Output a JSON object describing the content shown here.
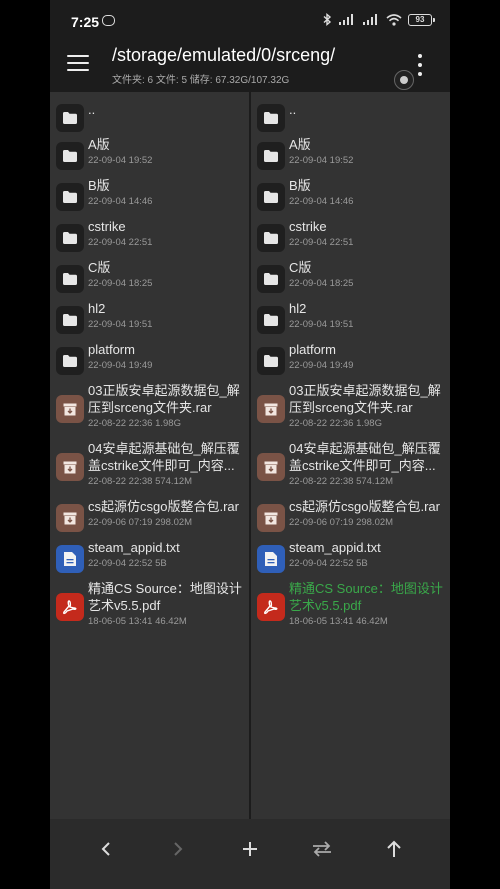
{
  "status": {
    "time": "7:25",
    "battery": "93"
  },
  "appbar": {
    "path": "/storage/emulated/0/srceng/",
    "info": "文件夹: 6  文件: 5  储存: 67.32G/107.32G"
  },
  "left_pane": {
    "items": [
      {
        "name": "..",
        "meta": "",
        "kind": "folder"
      },
      {
        "name": "A版",
        "meta": "22-09-04 19:52",
        "kind": "folder"
      },
      {
        "name": "B版",
        "meta": "22-09-04 14:46",
        "kind": "folder"
      },
      {
        "name": "cstrike",
        "meta": "22-09-04 22:51",
        "kind": "folder"
      },
      {
        "name": "C版",
        "meta": "22-09-04 18:25",
        "kind": "folder"
      },
      {
        "name": "hl2",
        "meta": "22-09-04 19:51",
        "kind": "folder"
      },
      {
        "name": "platform",
        "meta": "22-09-04 19:49",
        "kind": "folder"
      },
      {
        "name": "03正版安卓起源数据包_解压到srceng文件夹.rar",
        "meta": "22-08-22 22:36  1.98G",
        "kind": "rar"
      },
      {
        "name": "04安卓起源基础包_解压覆盖cstrike文件即可_内容...",
        "meta": "22-08-22 22:38  574.12M",
        "kind": "rar"
      },
      {
        "name": "cs起源仿csgo版整合包.rar",
        "meta": "22-09-06 07:19  298.02M",
        "kind": "rar"
      },
      {
        "name": "steam_appid.txt",
        "meta": "22-09-04 22:52  5B",
        "kind": "txt"
      },
      {
        "name": "精通CS Source：地图设计艺术v5.5.pdf",
        "meta": "18-06-05 13:41  46.42M",
        "kind": "pdf"
      }
    ]
  },
  "right_pane": {
    "items": [
      {
        "name": "..",
        "meta": "",
        "kind": "folder"
      },
      {
        "name": "A版",
        "meta": "22-09-04 19:52",
        "kind": "folder"
      },
      {
        "name": "B版",
        "meta": "22-09-04 14:46",
        "kind": "folder"
      },
      {
        "name": "cstrike",
        "meta": "22-09-04 22:51",
        "kind": "folder"
      },
      {
        "name": "C版",
        "meta": "22-09-04 18:25",
        "kind": "folder"
      },
      {
        "name": "hl2",
        "meta": "22-09-04 19:51",
        "kind": "folder"
      },
      {
        "name": "platform",
        "meta": "22-09-04 19:49",
        "kind": "folder"
      },
      {
        "name": "03正版安卓起源数据包_解压到srceng文件夹.rar",
        "meta": "22-08-22 22:36  1.98G",
        "kind": "rar"
      },
      {
        "name": "04安卓起源基础包_解压覆盖cstrike文件即可_内容...",
        "meta": "22-08-22 22:38  574.12M",
        "kind": "rar"
      },
      {
        "name": "cs起源仿csgo版整合包.rar",
        "meta": "22-09-06 07:19  298.02M",
        "kind": "rar"
      },
      {
        "name": "steam_appid.txt",
        "meta": "22-09-04 22:52  5B",
        "kind": "txt"
      },
      {
        "name": "精通CS Source：地图设计艺术v5.5.pdf",
        "meta": "18-06-05 13:41  46.42M",
        "kind": "pdf",
        "highlighted": true
      }
    ]
  },
  "colors": {
    "highlight": "#3aa84a",
    "rar": "#7a5346",
    "txt": "#2f5fb8",
    "pdf": "#c42a1c"
  }
}
